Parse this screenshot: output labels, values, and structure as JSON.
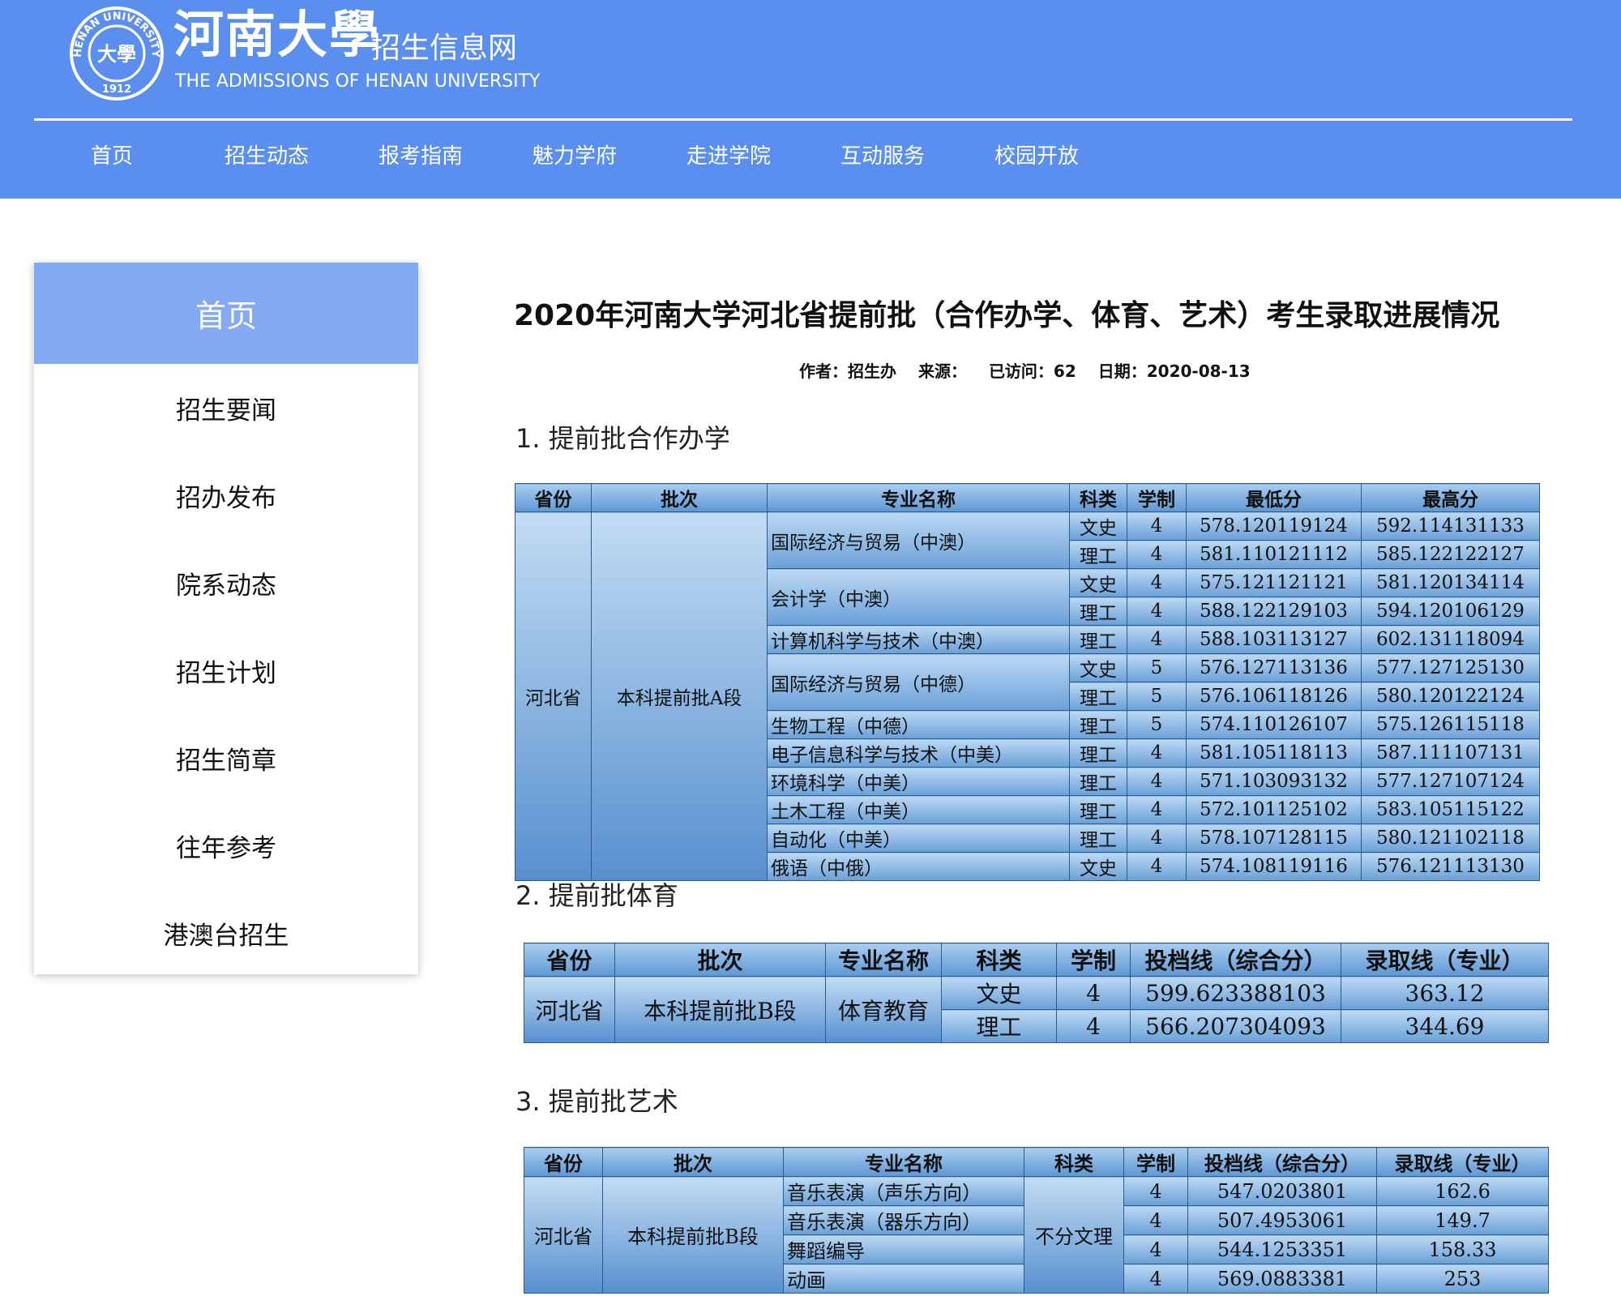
{
  "header": {
    "logo_cn": "河南大學",
    "logo_sub": "招生信息网",
    "logo_en": "THE ADMISSIONS OF HENAN UNIVERSITY",
    "seal_text": "HENAN UNIVERSITY",
    "seal_year": "1912",
    "seal_center": "大學",
    "bg_color": "#5a8ff0"
  },
  "nav": [
    "首页",
    "招生动态",
    "报考指南",
    "魅力学府",
    "走进学院",
    "互动服务",
    "校园开放"
  ],
  "sidebar": {
    "header": "首页",
    "items": [
      "招生要闻",
      "招办发布",
      "院系动态",
      "招生计划",
      "招生简章",
      "往年参考",
      "港澳台招生"
    ]
  },
  "article": {
    "title": "2020年河南大学河北省提前批（合作办学、体育、艺术）考生录取进展情况",
    "author": "作者：招生办",
    "source": "来源：",
    "visits": "已访问：62",
    "date": "日期：2020-08-13",
    "sections": [
      "1. 提前批合作办学",
      "2. 提前批体育",
      "3. 提前批艺术"
    ]
  },
  "table1": {
    "headers": [
      "省份",
      "批次",
      "专业名称",
      "科类",
      "学制",
      "最低分",
      "最高分"
    ],
    "province": "河北省",
    "batch": "本科提前批A段",
    "rows": [
      {
        "major": "国际经济与贸易（中澳）",
        "cat": "文史",
        "years": "4",
        "min": "578.120119124",
        "max": "592.114131133"
      },
      {
        "major": "",
        "cat": "理工",
        "years": "4",
        "min": "581.110121112",
        "max": "585.122122127"
      },
      {
        "major": "会计学（中澳）",
        "cat": "文史",
        "years": "4",
        "min": "575.121121121",
        "max": "581.120134114"
      },
      {
        "major": "",
        "cat": "理工",
        "years": "4",
        "min": "588.122129103",
        "max": "594.120106129"
      },
      {
        "major": "计算机科学与技术（中澳）",
        "cat": "理工",
        "years": "4",
        "min": "588.103113127",
        "max": "602.131118094"
      },
      {
        "major": "国际经济与贸易（中德）",
        "cat": "文史",
        "years": "5",
        "min": "576.127113136",
        "max": "577.127125130"
      },
      {
        "major": "",
        "cat": "理工",
        "years": "5",
        "min": "576.106118126",
        "max": "580.120122124"
      },
      {
        "major": "生物工程（中德）",
        "cat": "理工",
        "years": "5",
        "min": "574.110126107",
        "max": "575.126115118"
      },
      {
        "major": "电子信息科学与技术（中美）",
        "cat": "理工",
        "years": "4",
        "min": "581.105118113",
        "max": "587.111107131"
      },
      {
        "major": "环境科学（中美）",
        "cat": "理工",
        "years": "4",
        "min": "571.103093132",
        "max": "577.127107124"
      },
      {
        "major": "土木工程（中美）",
        "cat": "理工",
        "years": "4",
        "min": "572.101125102",
        "max": "583.105115122"
      },
      {
        "major": "自动化（中美）",
        "cat": "理工",
        "years": "4",
        "min": "578.107128115",
        "max": "580.121102118"
      },
      {
        "major": "俄语（中俄）",
        "cat": "文史",
        "years": "4",
        "min": "574.108119116",
        "max": "576.121113130"
      }
    ]
  },
  "table2": {
    "headers": [
      "省份",
      "批次",
      "专业名称",
      "科类",
      "学制",
      "投档线（综合分）",
      "录取线（专业）"
    ],
    "province": "河北省",
    "batch": "本科提前批B段",
    "major": "体育教育",
    "rows": [
      {
        "cat": "文史",
        "years": "4",
        "score": "599.623388103",
        "line": "363.12"
      },
      {
        "cat": "理工",
        "years": "4",
        "score": "566.207304093",
        "line": "344.69"
      }
    ]
  },
  "table3": {
    "headers": [
      "省份",
      "批次",
      "专业名称",
      "科类",
      "学制",
      "投档线（综合分）",
      "录取线（专业）"
    ],
    "province": "河北省",
    "batch": "本科提前批B段",
    "cat": "不分文理",
    "rows": [
      {
        "major": "音乐表演（声乐方向）",
        "years": "4",
        "score": "547.0203801",
        "line": "162.6"
      },
      {
        "major": "音乐表演（器乐方向）",
        "years": "4",
        "score": "507.4953061",
        "line": "149.7"
      },
      {
        "major": "舞蹈编导",
        "years": "4",
        "score": "544.1253351",
        "line": "158.33"
      },
      {
        "major": "动画",
        "years": "4",
        "score": "569.0883381",
        "line": "253"
      }
    ]
  }
}
